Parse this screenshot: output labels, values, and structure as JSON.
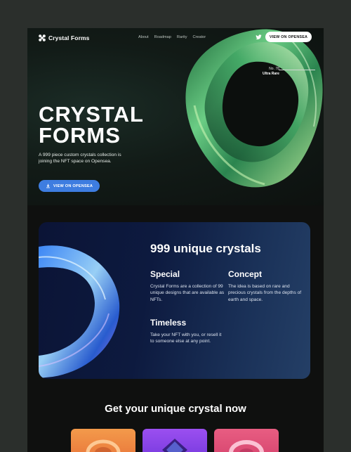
{
  "brand": {
    "name": "Crystal Forms"
  },
  "nav": {
    "items": [
      "About",
      "Roadmap",
      "Rarity",
      "Creator"
    ]
  },
  "header": {
    "cta_label": "VIEW ON OPENSEA"
  },
  "hero": {
    "badge_number": "No. 78",
    "badge_tier": "Ultra Rare",
    "title_line1": "CRYSTAL",
    "title_line2": "FORMS",
    "description": "A 999 piece custom crystals collection is joining the NFT space on Opensea.",
    "cta_label": "VIEW ON OPENSEA"
  },
  "features": {
    "title": "999 unique crystals",
    "items": [
      {
        "heading": "Special",
        "text": "Crystal Forms are a collection of 99 unique designs that are available as NFTs."
      },
      {
        "heading": "Concept",
        "text": "The idea is based on rare and precious crystals from the depths of earth and space."
      },
      {
        "heading": "Timeless",
        "text": "Take your NFT with you, or resell it to someone else at any point."
      }
    ]
  },
  "collection": {
    "title": "Get your unique crystal now"
  },
  "colors": {
    "accent": "#3e7de0",
    "card_bg": "#0d1a3f",
    "page_bg": "#0f100f"
  },
  "icons": {
    "logo": "crystal-logo-icon",
    "social": "twitter-icon",
    "download": "download-icon"
  }
}
